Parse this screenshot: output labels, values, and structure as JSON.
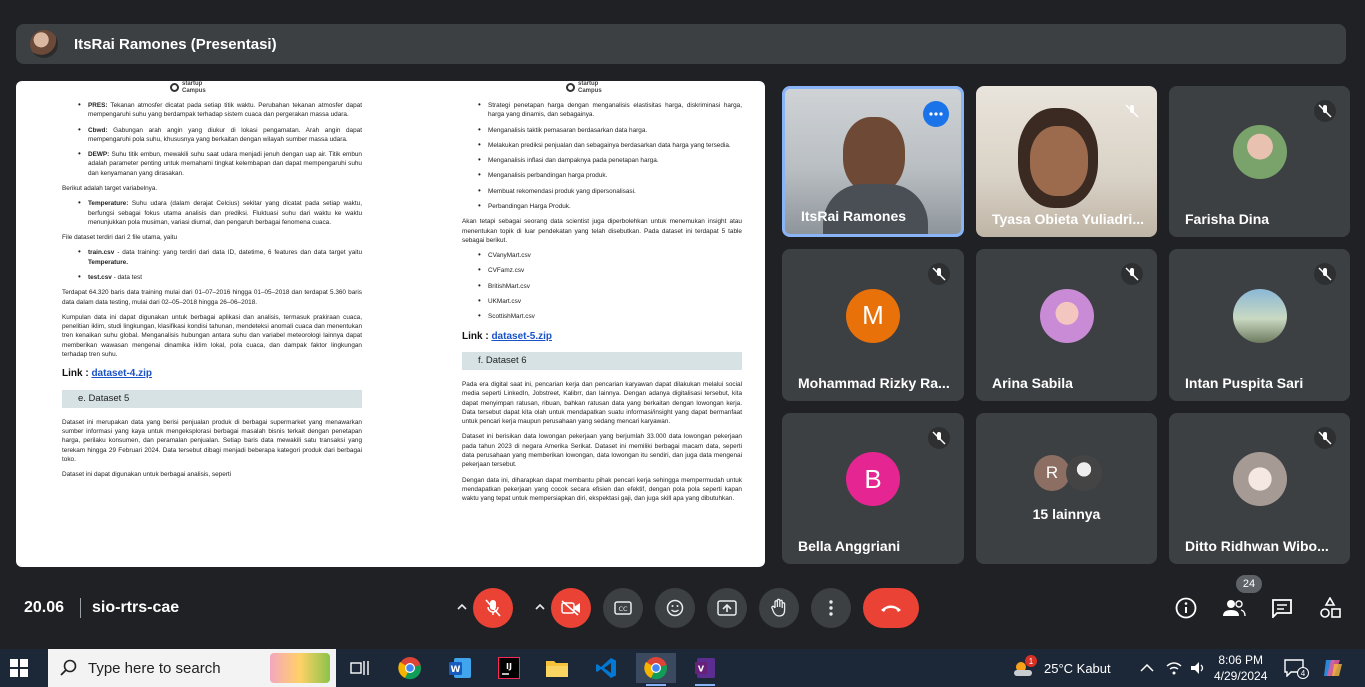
{
  "header": {
    "presenter_title": "ItsRai Ramones (Presentasi)"
  },
  "presentation": {
    "logo_line1": "startup",
    "logo_line2": "Campus",
    "left": {
      "bullets_top": [
        {
          "term": "PRES:",
          "text": " Tekanan atmosfer dicatat pada setiap titik waktu. Perubahan tekanan atmosfer dapat mempengaruhi suhu yang berdampak terhadap sistem cuaca dan pergerakan massa udara."
        },
        {
          "term": "Cbwd:",
          "text": " Gabungan arah angin yang diukur di lokasi pengamatan. Arah angin dapat mempengaruhi pola suhu, khususnya yang berkaitan dengan wilayah sumber massa udara."
        },
        {
          "term": "DEWP:",
          "text": " Suhu titik embun, mewakili suhu saat udara menjadi jenuh dengan uap air. Titik embun adalah parameter penting untuk memahami tingkat kelembapan dan dapat mempengaruhi suhu dan kenyamanan yang dirasakan."
        }
      ],
      "target_intro": "Berikut adalah target variabelnya.",
      "target_bullet": {
        "term": "Temperature:",
        "text": " Suhu udara (dalam derajat Celcius) sekitar yang dicatat pada setiap waktu, berfungsi sebagai fokus utama analisis dan prediksi. Fluktuasi suhu dari waktu ke waktu menunjukkan pola musiman, variasi diurnal, dan pengaruh berbagai fenomena cuaca."
      },
      "files_intro": "File dataset terdiri dari 2 file utama, yaitu",
      "file_bullets": [
        {
          "term": "train.csv",
          "text": " - data training: yang terdiri dari data ID, datetime, 6 features dan data target yaitu ",
          "term2": "Temperature."
        },
        {
          "term": "test.csv",
          "text": " - data test",
          "term2": ""
        }
      ],
      "para1": "Terdapat 64.320 baris data training mulai dari 01–07–2016 hingga 01–05–2018 dan terdapat 5.360 baris data dalam data testing, mulai dari 02–05–2018 hingga 26–06–2018.",
      "para2": "Kumpulan data ini dapat digunakan untuk berbagai aplikasi dan analisis, termasuk prakiraan cuaca, penelitian iklim, studi lingkungan, klasifikasi kondisi tahunan, mendeteksi anomali cuaca dan menentukan tren kenaikan suhu global. Menganalisis hubungan antara suhu dan variabel meteorologi lainnya dapat memberikan wawasan mengenai dinamika iklim lokal, pola cuaca, dan dampak faktor lingkungan terhadap tren suhu.",
      "link_label": "Link",
      "link_sep": " : ",
      "link_text": "dataset-4.zip",
      "section": "e.  Dataset 5",
      "para3": "Dataset ini merupakan data yang berisi penjualan produk di berbagai supermarket yang menawarkan sumber informasi yang kaya untuk mengeksplorasi berbagai masalah bisnis terkait dengan penetapan harga, perilaku konsumen, dan peramalan penjualan. Setiap baris data mewakili satu transaksi yang terekam hingga 29 Februari 2024. Data tersebut dibagi menjadi beberapa kategori produk dari berbagai toko.",
      "para4": "Dataset ini dapat digunakan untuk berbagai analisis, seperti"
    },
    "right": {
      "bullets": [
        "Strategi penetapan harga dengan menganalisis elastisitas harga, diskriminasi harga, harga yang dinamis, dan sebagainya.",
        "Menganalisis taktik pemasaran berdasarkan data harga.",
        "Melakukan prediksi penjualan dan sebagainya berdasarkan data harga yang tersedia.",
        "Menganalisis inflasi dan dampaknya pada penetapan harga.",
        "Menganalisis perbandingan harga produk.",
        "Membuat rekomendasi produk yang dipersonalisasi.",
        "Perbandingan Harga Produk."
      ],
      "para1": "Akan tetapi sebagai seorang data scientist juga diperbolehkan untuk menemukan insight atau menentukan topik di luar pendekatan yang telah disebutkan. Pada dataset ini terdapat 5 table sebagai berikut.",
      "files": [
        "CVanyMart.csv",
        "CVFamz.csv",
        "BritishMart.csv",
        "UKMart.csv",
        "ScottishMart.csv"
      ],
      "link_label": "Link",
      "link_sep": " : ",
      "link_text": "dataset-5.zip",
      "section": "f.  Dataset 6",
      "para2": "Pada era digital saat ini, pencarian kerja dan pencarian karyawan dapat dilakukan melalui social media seperti LinkedIn, Jobstreet, Kalibrr, dan lainnya. Dengan adanya digitalisasi tersebut, kita dapat menyimpan ratusan, ribuan, bahkan ratusan data yang berkaitan dengan lowongan kerja. Data tersebut dapat kita olah untuk mendapatkan suatu informasi/insight yang dapat bermanfaat untuk pencari kerja maupun perusahaan yang sedang mencari karyawan.",
      "para3": "Dataset ini berisikan data lowongan pekerjaan yang berjumlah 33.000 data lowongan pekerjaan pada tahun 2023 di negara Amerika Serikat. Dataset ini memiliki berbagai macam data, seperti data perusahaan yang memberikan lowongan, data lowongan itu sendiri, dan juga data mengenai pekerjaan tersebut.",
      "para4": "Dengan data ini, diharapkan dapat membantu pihak pencari kerja sehingga mempermudah untuk mendapatkan pekerjaan yang cocok secara efisien dan efektif, dengan pola pola seperti kapan waktu yang tepat untuk mempersiapkan diri, ekspektasi gaji, dan juga skill apa yang dibutuhkan."
    }
  },
  "participants": [
    {
      "name": "ItsRai Ramones"
    },
    {
      "name": "Tyasa Obieta Yuliadri..."
    },
    {
      "name": "Farisha Dina"
    },
    {
      "name": "Mohammad Rizky Ra...",
      "initial": "M",
      "color": "#e8710a"
    },
    {
      "name": "Arina Sabila"
    },
    {
      "name": "Intan Puspita Sari"
    },
    {
      "name": "Bella Anggriani",
      "initial": "B",
      "color": "#e52592"
    },
    {
      "name": "15 lainnya",
      "initial": "R"
    },
    {
      "name": "Ditto Ridhwan Wibo..."
    }
  ],
  "meeting": {
    "time": "20.06",
    "code": "sio-rtrs-cae",
    "participant_count": "24"
  },
  "taskbar": {
    "search_placeholder": "Type here to search",
    "weather": "25°C  Kabut",
    "clock_time": "8:06 PM",
    "clock_date": "4/29/2024",
    "notification_count": "4",
    "weather_badge": "1"
  },
  "colors": {
    "accent": "#8ab4f8",
    "danger": "#ea4335",
    "tile": "#3c4043",
    "background": "#202124"
  }
}
